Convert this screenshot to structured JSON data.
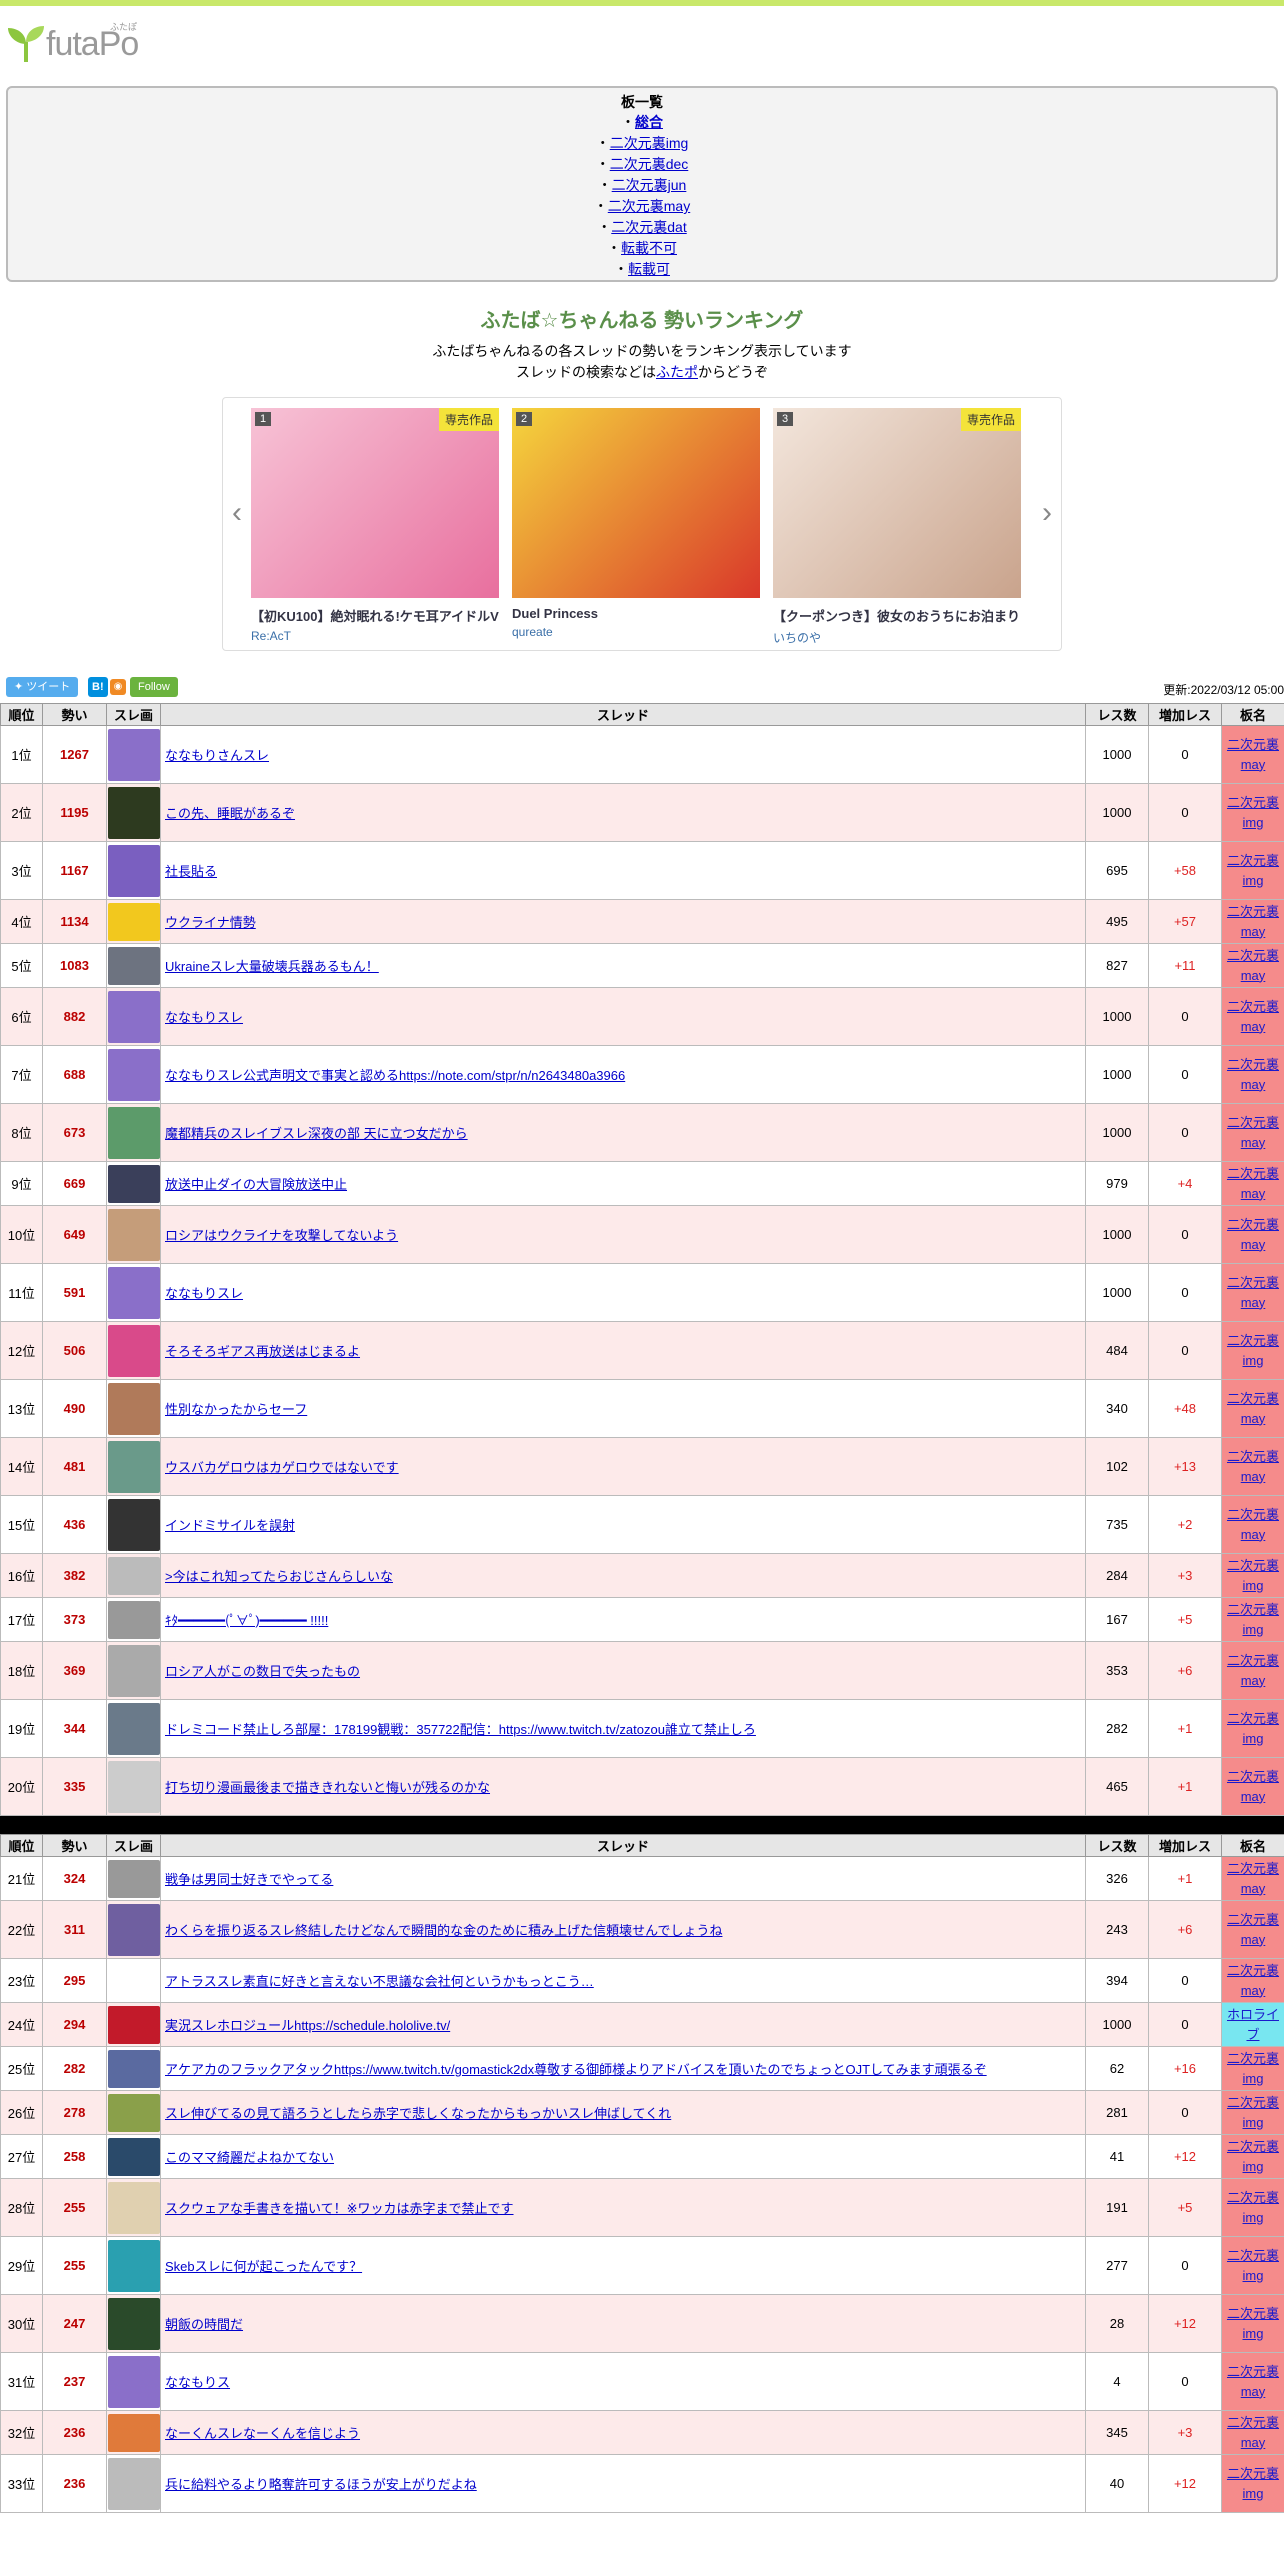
{
  "logo": {
    "text": "futaPo",
    "ruby": "ふたぽ"
  },
  "boards": {
    "title": "板一覧",
    "items": [
      "総合",
      "二次元裏img",
      "二次元裏dec",
      "二次元裏jun",
      "二次元裏may",
      "二次元裏dat",
      "転載不可",
      "転載可"
    ]
  },
  "ranking": {
    "title": "ふたば☆ちゃんねる 勢いランキング",
    "desc1": "ふたばちゃんねるの各スレッドの勢いをランキング表示しています",
    "desc2_pre": "スレッドの検索などは",
    "desc2_link": "ふたポ",
    "desc2_post": "からどうぞ"
  },
  "carousel": {
    "prev": "‹",
    "next": "›",
    "slides": [
      {
        "num": "1",
        "badge": "専売作品",
        "title": "【初KU100】絶対眠れる!ケモ耳アイドルV",
        "author": "Re:AcT",
        "color_a": "#f7c3d6",
        "color_b": "#e86f9e"
      },
      {
        "num": "2",
        "badge": "",
        "title": "Duel Princess",
        "author": "qureate",
        "color_a": "#f5d63d",
        "color_b": "#d9372a"
      },
      {
        "num": "3",
        "badge": "専売作品",
        "title": "【クーポンつき】彼女のおうちにお泊まり",
        "author": "いちのや",
        "color_a": "#f3e6dc",
        "color_b": "#c9a38c"
      }
    ]
  },
  "share": {
    "tweet": "ツイート",
    "hatena": "B!",
    "rss": "◉",
    "follow": "Follow",
    "updated": "更新:2022/03/12 05:00"
  },
  "table_headers": {
    "rank": "順位",
    "ikioi": "勢い",
    "img": "スレ画",
    "thread": "スレッド",
    "res": "レス数",
    "inc": "増加レス",
    "board": "板名"
  },
  "rows": [
    {
      "rank": "1位",
      "ikioi": "1267",
      "title": "ななもりさんスレ",
      "res": "1000",
      "inc": "0",
      "board1": "二次元裏",
      "board2": "may",
      "h": 58,
      "thumb": "#8a6fc9"
    },
    {
      "rank": "2位",
      "ikioi": "1195",
      "title": "この先、睡眠があるぞ",
      "res": "1000",
      "inc": "0",
      "board1": "二次元裏",
      "board2": "img",
      "h": 58,
      "thumb": "#2d3a1f"
    },
    {
      "rank": "3位",
      "ikioi": "1167",
      "title": "社長貼る",
      "res": "695",
      "inc": "+58",
      "board1": "二次元裏",
      "board2": "img",
      "h": 58,
      "thumb": "#7a5fc0"
    },
    {
      "rank": "4位",
      "ikioi": "1134",
      "title": "ウクライナ情勢",
      "res": "495",
      "inc": "+57",
      "board1": "二次元裏",
      "board2": "may",
      "h": 44,
      "thumb": "#f2c81e"
    },
    {
      "rank": "5位",
      "ikioi": "1083",
      "title": "Ukraineスレ大量破壊兵器あるもん！",
      "res": "827",
      "inc": "+11",
      "board1": "二次元裏",
      "board2": "may",
      "h": 44,
      "thumb": "#6d7380"
    },
    {
      "rank": "6位",
      "ikioi": "882",
      "title": "ななもりスレ",
      "res": "1000",
      "inc": "0",
      "board1": "二次元裏",
      "board2": "may",
      "h": 58,
      "thumb": "#8a6fc9"
    },
    {
      "rank": "7位",
      "ikioi": "688",
      "title": "ななもりスレ公式声明文で事実と認めるhttps://note.com/stpr/n/n2643480a3966",
      "res": "1000",
      "inc": "0",
      "board1": "二次元裏",
      "board2": "may",
      "h": 58,
      "thumb": "#8a6fc9"
    },
    {
      "rank": "8位",
      "ikioi": "673",
      "title": "魔都精兵のスレイブスレ深夜の部 天に立つ女だから",
      "res": "1000",
      "inc": "0",
      "board1": "二次元裏",
      "board2": "may",
      "h": 58,
      "thumb": "#5c9b6a"
    },
    {
      "rank": "9位",
      "ikioi": "669",
      "title": "放送中止ダイの大冒険放送中止",
      "res": "979",
      "inc": "+4",
      "board1": "二次元裏",
      "board2": "may",
      "h": 44,
      "thumb": "#3a3f5a"
    },
    {
      "rank": "10位",
      "ikioi": "649",
      "title": "ロシアはウクライナを攻撃してないよう",
      "res": "1000",
      "inc": "0",
      "board1": "二次元裏",
      "board2": "may",
      "h": 58,
      "thumb": "#c59d7a"
    },
    {
      "rank": "11位",
      "ikioi": "591",
      "title": "ななもりスレ",
      "res": "1000",
      "inc": "0",
      "board1": "二次元裏",
      "board2": "may",
      "h": 58,
      "thumb": "#8a6fc9"
    },
    {
      "rank": "12位",
      "ikioi": "506",
      "title": "そろそろギアス再放送はじまるよ",
      "res": "484",
      "inc": "0",
      "board1": "二次元裏",
      "board2": "img",
      "h": 58,
      "thumb": "#d94a8a"
    },
    {
      "rank": "13位",
      "ikioi": "490",
      "title": "性別なかったからセーフ",
      "res": "340",
      "inc": "+48",
      "board1": "二次元裏",
      "board2": "may",
      "h": 58,
      "thumb": "#b07a5a"
    },
    {
      "rank": "14位",
      "ikioi": "481",
      "title": "ウスバカゲロウはカゲロウではないです",
      "res": "102",
      "inc": "+13",
      "board1": "二次元裏",
      "board2": "may",
      "h": 58,
      "thumb": "#6a9a8a"
    },
    {
      "rank": "15位",
      "ikioi": "436",
      "title": "インドミサイルを誤射",
      "res": "735",
      "inc": "+2",
      "board1": "二次元裏",
      "board2": "may",
      "h": 58,
      "thumb": "#333333"
    },
    {
      "rank": "16位",
      "ikioi": "382",
      "title": ">今はこれ知ってたらおじさんらしいな",
      "res": "284",
      "inc": "+3",
      "board1": "二次元裏",
      "board2": "img",
      "h": 44,
      "thumb": "#bbbbbb"
    },
    {
      "rank": "17位",
      "ikioi": "373",
      "title": "ｷﾀ━━━━━━(ﾟ∀ﾟ)━━━━━━ !!!!!",
      "res": "167",
      "inc": "+5",
      "board1": "二次元裏",
      "board2": "img",
      "h": 44,
      "thumb": "#999999"
    },
    {
      "rank": "18位",
      "ikioi": "369",
      "title": "ロシア人がこの数日で失ったもの",
      "res": "353",
      "inc": "+6",
      "board1": "二次元裏",
      "board2": "may",
      "h": 58,
      "thumb": "#aaaaaa"
    },
    {
      "rank": "19位",
      "ikioi": "344",
      "title": "ドレミコード禁止しろ部屋：178199観戦：357722配信：https://www.twitch.tv/zatozou誰立て禁止しろ",
      "res": "282",
      "inc": "+1",
      "board1": "二次元裏",
      "board2": "img",
      "h": 58,
      "thumb": "#6a7a8a"
    },
    {
      "rank": "20位",
      "ikioi": "335",
      "title": "打ち切り漫画最後まで描ききれないと悔いが残るのかな",
      "res": "465",
      "inc": "+1",
      "board1": "二次元裏",
      "board2": "may",
      "h": 58,
      "thumb": "#cccccc"
    }
  ],
  "rows2": [
    {
      "rank": "21位",
      "ikioi": "324",
      "title": "戦争は男同士好きでやってる",
      "res": "326",
      "inc": "+1",
      "board1": "二次元裏",
      "board2": "may",
      "h": 44,
      "thumb": "#999999"
    },
    {
      "rank": "22位",
      "ikioi": "311",
      "title": "わくらを振り返るスレ終結したけどなんで瞬間的な金のために積み上げた信頼壊せんでしょうね",
      "res": "243",
      "inc": "+6",
      "board1": "二次元裏",
      "board2": "may",
      "h": 58,
      "thumb": "#6f5fa0"
    },
    {
      "rank": "23位",
      "ikioi": "295",
      "title": "アトラススレ素直に好きと言えない不思議な会社何というかもっとこう…",
      "res": "394",
      "inc": "0",
      "board1": "二次元裏",
      "board2": "may",
      "h": 44,
      "thumb": "#ffffff"
    },
    {
      "rank": "24位",
      "ikioi": "294",
      "title": "実況スレホロジュールhttps://schedule.hololive.tv/",
      "res": "1000",
      "inc": "0",
      "board1": "ホロライ",
      "board2": "ブ",
      "h": 44,
      "thumb": "#c21a2a",
      "holo": true
    },
    {
      "rank": "25位",
      "ikioi": "282",
      "title": "アケアカのフラックアタックhttps://www.twitch.tv/gomastick2dx尊敬する御師様よりアドバイスを頂いたのでちょっとOJTしてみます頑張るぞ",
      "res": "62",
      "inc": "+16",
      "board1": "二次元裏",
      "board2": "img",
      "h": 44,
      "thumb": "#5a6aa0"
    },
    {
      "rank": "26位",
      "ikioi": "278",
      "title": "スレ伸びてるの見て語ろうとしたら赤字で悲しくなったからもっかいスレ伸ばしてくれ",
      "res": "281",
      "inc": "0",
      "board1": "二次元裏",
      "board2": "img",
      "h": 44,
      "thumb": "#8aa04a"
    },
    {
      "rank": "27位",
      "ikioi": "258",
      "title": "このママ綺麗だよねかてない",
      "res": "41",
      "inc": "+12",
      "board1": "二次元裏",
      "board2": "img",
      "h": 44,
      "thumb": "#2a4a6a"
    },
    {
      "rank": "28位",
      "ikioi": "255",
      "title": "スクウェアな手書きを描いて！※ワッカは赤字まで禁止です",
      "res": "191",
      "inc": "+5",
      "board1": "二次元裏",
      "board2": "img",
      "h": 58,
      "thumb": "#e0d0b0"
    },
    {
      "rank": "29位",
      "ikioi": "255",
      "title": "Skebスレに何が起こったんです？",
      "res": "277",
      "inc": "0",
      "board1": "二次元裏",
      "board2": "img",
      "h": 58,
      "thumb": "#2aa0b0"
    },
    {
      "rank": "30位",
      "ikioi": "247",
      "title": "朝飯の時間だ",
      "res": "28",
      "inc": "+12",
      "board1": "二次元裏",
      "board2": "img",
      "h": 58,
      "thumb": "#2a4a2a"
    },
    {
      "rank": "31位",
      "ikioi": "237",
      "title": "ななもりス",
      "res": "4",
      "inc": "0",
      "board1": "二次元裏",
      "board2": "may",
      "h": 58,
      "thumb": "#8a6fc9"
    },
    {
      "rank": "32位",
      "ikioi": "236",
      "title": "なーくんスレなーくんを信じよう",
      "res": "345",
      "inc": "+3",
      "board1": "二次元裏",
      "board2": "may",
      "h": 44,
      "thumb": "#e07a3a"
    },
    {
      "rank": "33位",
      "ikioi": "236",
      "title": "兵に給料やるより略奪許可するほうが安上がりだよね",
      "res": "40",
      "inc": "+12",
      "board1": "二次元裏",
      "board2": "img",
      "h": 58,
      "thumb": "#bbbbbb"
    }
  ]
}
